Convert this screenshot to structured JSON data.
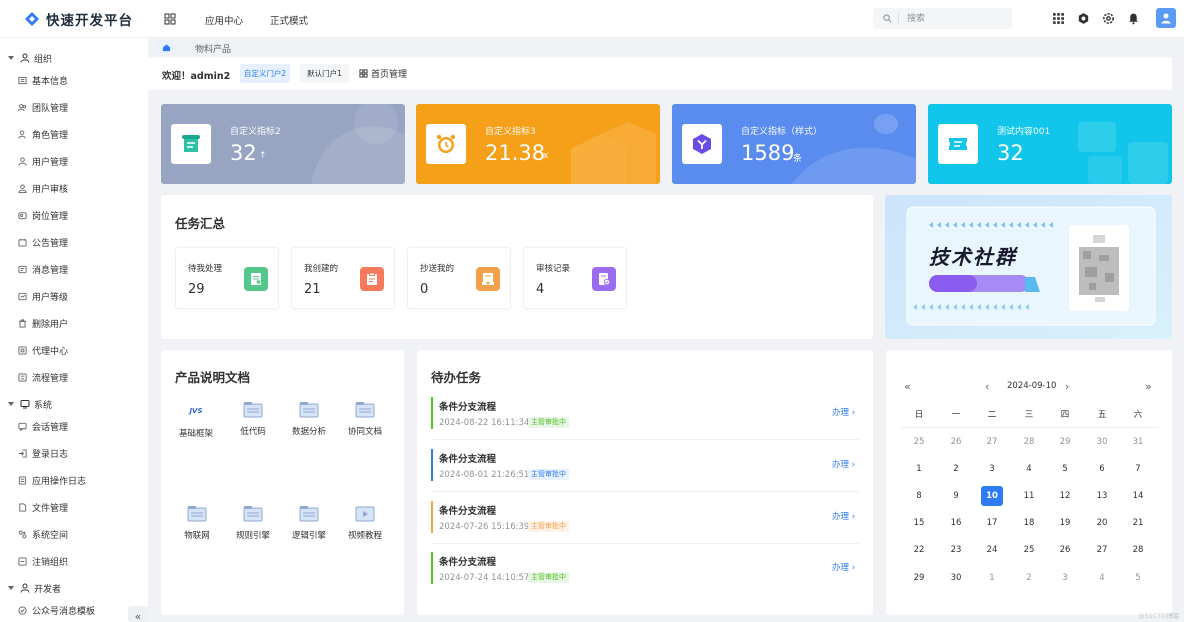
{
  "app": {
    "title": "快速开发平台"
  },
  "header": {
    "nav": [
      "应用中心",
      "正式模式"
    ],
    "search_placeholder": "搜索"
  },
  "sidebar": {
    "groups": [
      {
        "label": "组织",
        "items": [
          "基本信息",
          "团队管理",
          "角色管理",
          "用户管理",
          "用户审核",
          "岗位管理",
          "公告管理",
          "消息管理",
          "用户等级",
          "删除用户",
          "代理中心",
          "流程管理"
        ]
      },
      {
        "label": "系统",
        "items": [
          "会话管理",
          "登录日志",
          "应用操作日志",
          "文件管理",
          "系统空间",
          "注销组织"
        ]
      },
      {
        "label": "开发者",
        "items": [
          "公众号消息模板"
        ]
      }
    ],
    "collapse_label": "«"
  },
  "tabs": {
    "product": "物料产品"
  },
  "welcome": {
    "text": "欢迎！admin2",
    "pill_active": "自定义门户2",
    "pill_default": "默认门户1",
    "home_mgmt": "首页管理"
  },
  "kpis": [
    {
      "label": "自定义指标2",
      "value": "32",
      "unit": "↑",
      "color": "#97a4c2"
    },
    {
      "label": "自定义指标3",
      "value": "21.38",
      "unit": "x",
      "color": "#f6a019"
    },
    {
      "label": "自定义指标（样式）",
      "value": "1589",
      "unit": "条",
      "color": "#5a8cf0"
    },
    {
      "label": "测试内容001",
      "value": "32",
      "unit": "",
      "color": "#11c6ea"
    }
  ],
  "task_summary": {
    "title": "任务汇总",
    "items": [
      {
        "label": "待我处理",
        "value": "29",
        "color": "#53c88a"
      },
      {
        "label": "我创建的",
        "value": "21",
        "color": "#f57a5c"
      },
      {
        "label": "抄送我的",
        "value": "0",
        "color": "#f5a04a"
      },
      {
        "label": "审核记录",
        "value": "4",
        "color": "#9a6df0"
      }
    ]
  },
  "banner": {
    "title": "技术社群"
  },
  "docs": {
    "title": "产品说明文档",
    "items": [
      "基础框架",
      "低代码",
      "数据分析",
      "协同文档",
      "物联网",
      "规则引擎",
      "逻辑引擎",
      "视频教程"
    ],
    "first_mark": "JVS"
  },
  "todo": {
    "title": "待办任务",
    "action_label": "办理",
    "items": [
      {
        "title": "条件分支流程",
        "time": "2024-08-22 16:11:34",
        "status": "主管审批中",
        "color": "#52c41a"
      },
      {
        "title": "条件分支流程",
        "time": "2024-08-01 21:26:51",
        "status": "主管审批中",
        "color": "#2f7bf6"
      },
      {
        "title": "条件分支流程",
        "time": "2024-07-26 15:16:39",
        "status": "主管审批中",
        "color": "#f5a04a"
      },
      {
        "title": "条件分支流程",
        "time": "2024-07-24 14:10:57",
        "status": "主管审批中",
        "color": "#52c41a"
      }
    ]
  },
  "calendar": {
    "date": "2024-09-10",
    "weekdays": [
      "日",
      "一",
      "二",
      "三",
      "四",
      "五",
      "六"
    ],
    "weeks": [
      [
        "25",
        "26",
        "27",
        "28",
        "29",
        "30",
        "31"
      ],
      [
        "1",
        "2",
        "3",
        "4",
        "5",
        "6",
        "7"
      ],
      [
        "8",
        "9",
        "10",
        "11",
        "12",
        "13",
        "14"
      ],
      [
        "15",
        "16",
        "17",
        "18",
        "19",
        "20",
        "21"
      ],
      [
        "22",
        "23",
        "24",
        "25",
        "26",
        "27",
        "28"
      ],
      [
        "29",
        "30",
        "1",
        "2",
        "3",
        "4",
        "5"
      ]
    ],
    "selected": "10"
  },
  "watermark": "@51CTO博客"
}
